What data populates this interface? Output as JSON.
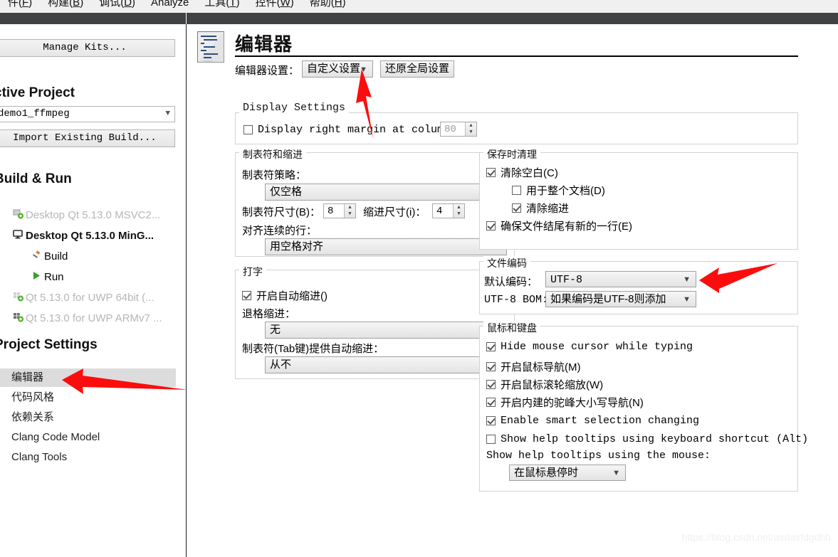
{
  "menubar": {
    "items": [
      {
        "label": "件(",
        "mnemonic": "F",
        "tail": ")"
      },
      {
        "label": "构建(",
        "mnemonic": "B",
        "tail": ")"
      },
      {
        "label": "调试(",
        "mnemonic": "D",
        "tail": ")"
      },
      {
        "label": "Analyze",
        "mnemonic": "",
        "tail": ""
      },
      {
        "label": "工具(",
        "mnemonic": "T",
        "tail": ")"
      },
      {
        "label": "控件(",
        "mnemonic": "W",
        "tail": ")"
      },
      {
        "label": "帮助(",
        "mnemonic": "H",
        "tail": ")"
      }
    ]
  },
  "sidebar": {
    "manage_kits_label": "Manage Kits...",
    "active_project_heading": "ctive Project",
    "active_project_value": "demo1_ffmpeg",
    "import_existing_build_label": "Import Existing Build...",
    "build_run_heading": "Build & Run",
    "kits": [
      {
        "label": "Desktop Qt 5.13.0 MSVC2...",
        "state": "dim",
        "icon": "desktop-kit-icon"
      },
      {
        "label": "Desktop Qt 5.13.0 MinG...",
        "state": "bold",
        "icon": "monitor-icon"
      },
      {
        "label": "Build",
        "state": "child",
        "icon": "hammer-icon"
      },
      {
        "label": "Run",
        "state": "child",
        "icon": "play-icon"
      },
      {
        "label": "Qt 5.13.0 for UWP 64bit (...",
        "state": "dim",
        "icon": "uwp-kit-icon"
      },
      {
        "label": "Qt 5.13.0 for UWP ARMv7 ...",
        "state": "dim",
        "icon": "uwp-kit-icon"
      }
    ],
    "project_settings_heading": "Project Settings",
    "project_settings": [
      {
        "label": "编辑器",
        "selected": true
      },
      {
        "label": "代码风格",
        "selected": false
      },
      {
        "label": "依赖关系",
        "selected": false
      },
      {
        "label": "Clang Code Model",
        "selected": false
      },
      {
        "label": "Clang Tools",
        "selected": false
      }
    ]
  },
  "content": {
    "page_title": "编辑器",
    "editor_settings_label": "编辑器设置：",
    "editor_settings_value": "自定义设置",
    "restore_global_label": "还原全局设置",
    "display_settings": {
      "title": "Display Settings",
      "right_margin_label": "Display right margin at column:",
      "right_margin_checked": false,
      "right_margin_value": "80"
    },
    "tabs_indent": {
      "title": "制表符和缩进",
      "tab_policy_label": "制表符策略：",
      "tab_policy_value": "仅空格",
      "tab_size_label": "制表符尺寸(B)：",
      "tab_size_value": "8",
      "indent_size_label": "缩进尺寸(i)：",
      "indent_size_value": "4",
      "align_cont_label": "对齐连续的行：",
      "align_cont_value": "用空格对齐"
    },
    "typing": {
      "title": "打字",
      "auto_indent_label": "开启自动缩进()",
      "auto_indent_checked": true,
      "backspace_label": "退格缩进：",
      "backspace_value": "无",
      "tabkey_label": "制表符(Tab键)提供自动缩进：",
      "tabkey_value": "从不"
    },
    "cleanup": {
      "title": "保存时清理",
      "items": [
        {
          "label": "清除空白(C)",
          "checked": true,
          "indent": 0
        },
        {
          "label": "用于整个文档(D)",
          "checked": false,
          "indent": 1
        },
        {
          "label": "清除缩进",
          "checked": true,
          "indent": 1
        },
        {
          "label": "确保文件结尾有新的一行(E)",
          "checked": true,
          "indent": 0
        }
      ]
    },
    "encoding": {
      "title": "文件编码",
      "default_label": "默认编码：",
      "default_value": "UTF-8",
      "bom_label": "UTF-8 BOM:",
      "bom_value": "如果编码是UTF-8则添加"
    },
    "mouse_keyboard": {
      "title": "鼠标和键盘",
      "items": [
        {
          "label": "Hide mouse cursor while typing",
          "checked": true,
          "mono": true
        },
        {
          "label": "开启鼠标导航(M)",
          "checked": true,
          "mono": false
        },
        {
          "label": "开启鼠标滚轮缩放(W)",
          "checked": true,
          "mono": false
        },
        {
          "label": "开启内建的驼峰大小写导航(N)",
          "checked": true,
          "mono": false
        },
        {
          "label": "Enable smart selection changing",
          "checked": true,
          "mono": true
        },
        {
          "label": "Show help tooltips using keyboard shortcut (Alt)",
          "checked": false,
          "mono": true
        }
      ],
      "tooltip_mouse_label": "Show help tooltips using the mouse:",
      "tooltip_mouse_value": "在鼠标悬停时"
    }
  },
  "watermark": "https://blog.csdn.net/asdasfdgdhh",
  "colors": {
    "toolbar_dark": "#414244",
    "selection_gray": "#dcdcdc",
    "arrow_red": "#fc0d0d",
    "icon_blue": "#2b4b80"
  }
}
